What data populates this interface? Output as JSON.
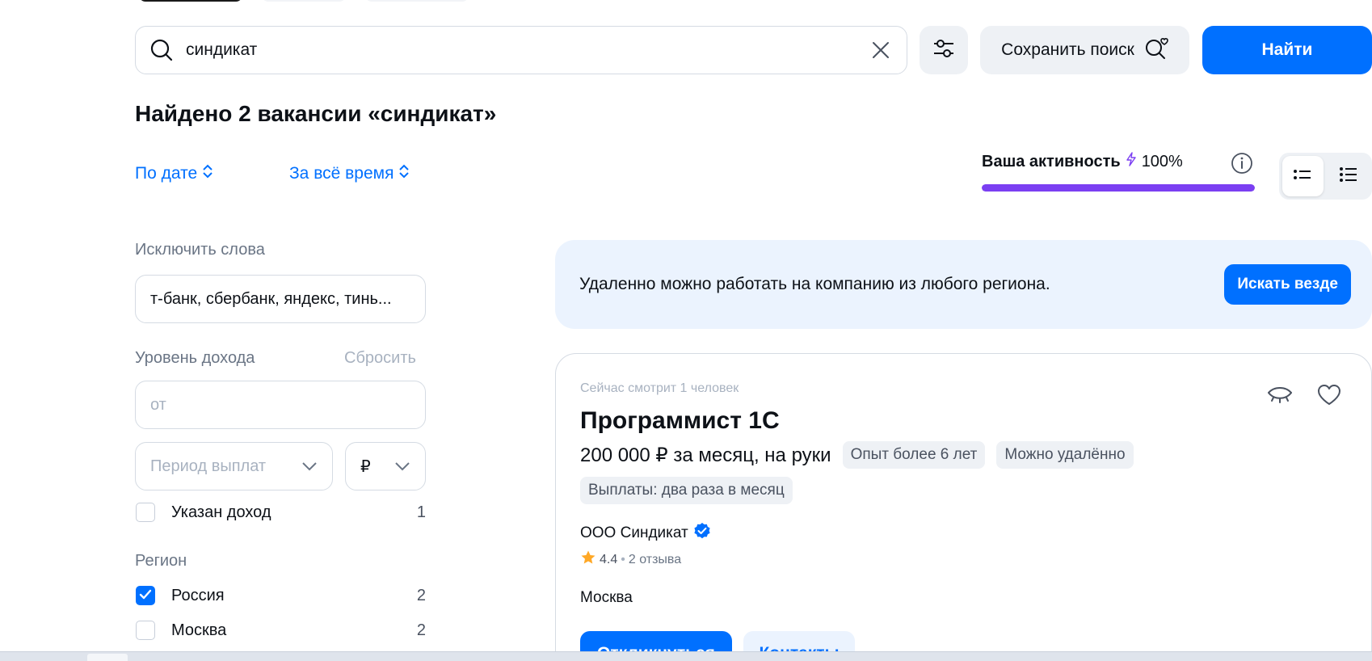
{
  "search": {
    "query": "синдикат",
    "save_label": "Сохранить поиск",
    "find_label": "Найти"
  },
  "results": {
    "title": "Найдено 2 вакансии «синдикат»",
    "sort_date": "По дате",
    "sort_period": "За всё время"
  },
  "activity": {
    "label": "Ваша активность",
    "value": "100%",
    "progress": 1.0
  },
  "filters": {
    "exclude_label": "Исключить слова",
    "exclude_value": "т-банк, сбербанк, яндекс, тинь...",
    "income_label": "Уровень дохода",
    "reset_label": "Сбросить",
    "income_placeholder": "от",
    "period_placeholder": "Период выплат",
    "currency": "₽",
    "income_specified": {
      "label": "Указан доход",
      "count": "1",
      "checked": false
    },
    "region_label": "Регион",
    "regions": [
      {
        "label": "Россия",
        "count": "2",
        "checked": true
      },
      {
        "label": "Москва",
        "count": "2",
        "checked": false
      }
    ]
  },
  "banner": {
    "text": "Удаленно можно работать на компанию из любого региона.",
    "button": "Искать везде"
  },
  "vacancy": {
    "watching": "Сейчас смотрит 1 человек",
    "title": "Программист 1С",
    "salary": "200 000 ₽ за месяц, на руки",
    "tags": [
      "Опыт более 6 лет",
      "Можно удалённо"
    ],
    "tags2": [
      "Выплаты: два раза в месяц"
    ],
    "company": "ООО Синдикат",
    "rating": "4.4",
    "reviews": "2 отзыва",
    "city": "Москва",
    "apply": "Откликнуться",
    "contacts": "Контакты"
  },
  "colors": {
    "accent": "#0070ff",
    "activity": "#7b3ff2",
    "star": "#ffa826"
  }
}
